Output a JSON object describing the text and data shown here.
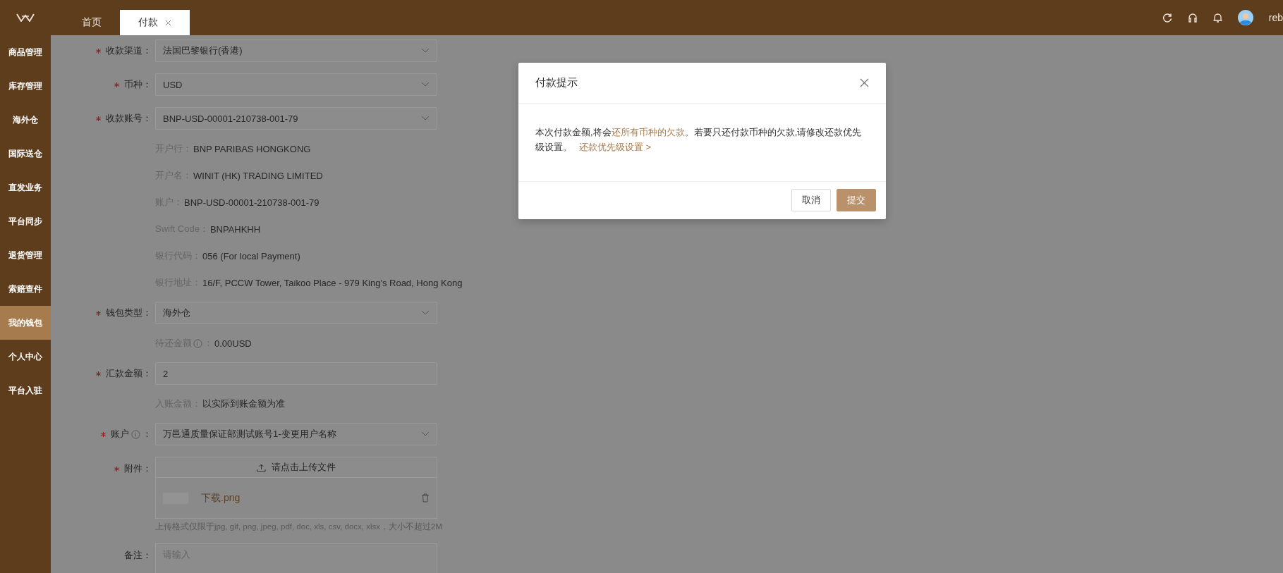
{
  "header": {
    "tabs": [
      {
        "label": "首页",
        "selected": false,
        "closable": false
      },
      {
        "label": "付款",
        "selected": true,
        "closable": true
      }
    ],
    "user": {
      "name": "reb"
    }
  },
  "sidebar": {
    "items": [
      {
        "label": "商品管理",
        "selected": false
      },
      {
        "label": "库存管理",
        "selected": false
      },
      {
        "label": "海外仓",
        "selected": false
      },
      {
        "label": "国际送仓",
        "selected": false
      },
      {
        "label": "直发业务",
        "selected": false
      },
      {
        "label": "平台同步",
        "selected": false
      },
      {
        "label": "退货管理",
        "selected": false
      },
      {
        "label": "索赔查件",
        "selected": false
      },
      {
        "label": "我的钱包",
        "selected": true
      },
      {
        "label": "个人中心",
        "selected": false
      },
      {
        "label": "平台入驻",
        "selected": false
      }
    ]
  },
  "form": {
    "rows": [
      {
        "kind": "select",
        "label": "收款渠道：",
        "required": true,
        "value": "法国巴黎银行(香港)"
      },
      {
        "kind": "select",
        "label": "币种：",
        "required": true,
        "value": "USD"
      },
      {
        "kind": "select",
        "label": "收款账号：",
        "required": true,
        "value": "BNP-USD-00001-210738-001-79"
      },
      {
        "kind": "info",
        "label": "开户行：",
        "value": "BNP PARIBAS HONGKONG"
      },
      {
        "kind": "info",
        "label": "开户名：",
        "value": "WINIT (HK) TRADING LIMITED"
      },
      {
        "kind": "info",
        "label": "账户：",
        "value": "BNP-USD-00001-210738-001-79"
      },
      {
        "kind": "info",
        "label": "Swift Code：",
        "value": "BNPAHKHH"
      },
      {
        "kind": "info",
        "label": "银行代码：",
        "value": "056 (For local Payment)"
      },
      {
        "kind": "info",
        "label": "银行地址：",
        "value": "16/F, PCCW Tower, Taikoo Place - 979 King's Road, Hong Kong"
      },
      {
        "kind": "select",
        "label": "钱包类型：",
        "required": true,
        "value": "海外仓"
      },
      {
        "kind": "info",
        "label": "待还金额",
        "info_icon": true,
        "suffix": "：",
        "value": "0.00USD"
      },
      {
        "kind": "input",
        "label": "汇款金额：",
        "required": true,
        "value": "2"
      },
      {
        "kind": "info",
        "label": "入账金额：",
        "value": "以实际到账金额为准"
      },
      {
        "kind": "select",
        "label": "账户",
        "required": true,
        "info_icon": true,
        "suffix": "：",
        "value": "万邑通质量保证部测试账号1-变更用户名称"
      },
      {
        "kind": "upload",
        "label": "附件：",
        "required": true,
        "button": "请点击上传文件",
        "file": "下载.png",
        "hint": "上传格式仅限于jpg, gif, png, jpeg, pdf, doc, xls, csv, docx, xlsx，大小不超过2M"
      },
      {
        "kind": "textarea",
        "label": "备注：",
        "required": false,
        "placeholder": "请输入"
      }
    ]
  },
  "dialog": {
    "title": "付款提示",
    "message": [
      {
        "text": "本次付款金额,将会",
        "highlight": false
      },
      {
        "text": "还所有币种的欠款",
        "highlight": true
      },
      {
        "text": "。若要只还付款币种的欠款,请修改还款优先级设置。",
        "highlight": false
      }
    ],
    "link": "还款优先级设置 >",
    "buttons": [
      {
        "label": "取消",
        "primary": false
      },
      {
        "label": "提交",
        "primary": true
      }
    ]
  }
}
